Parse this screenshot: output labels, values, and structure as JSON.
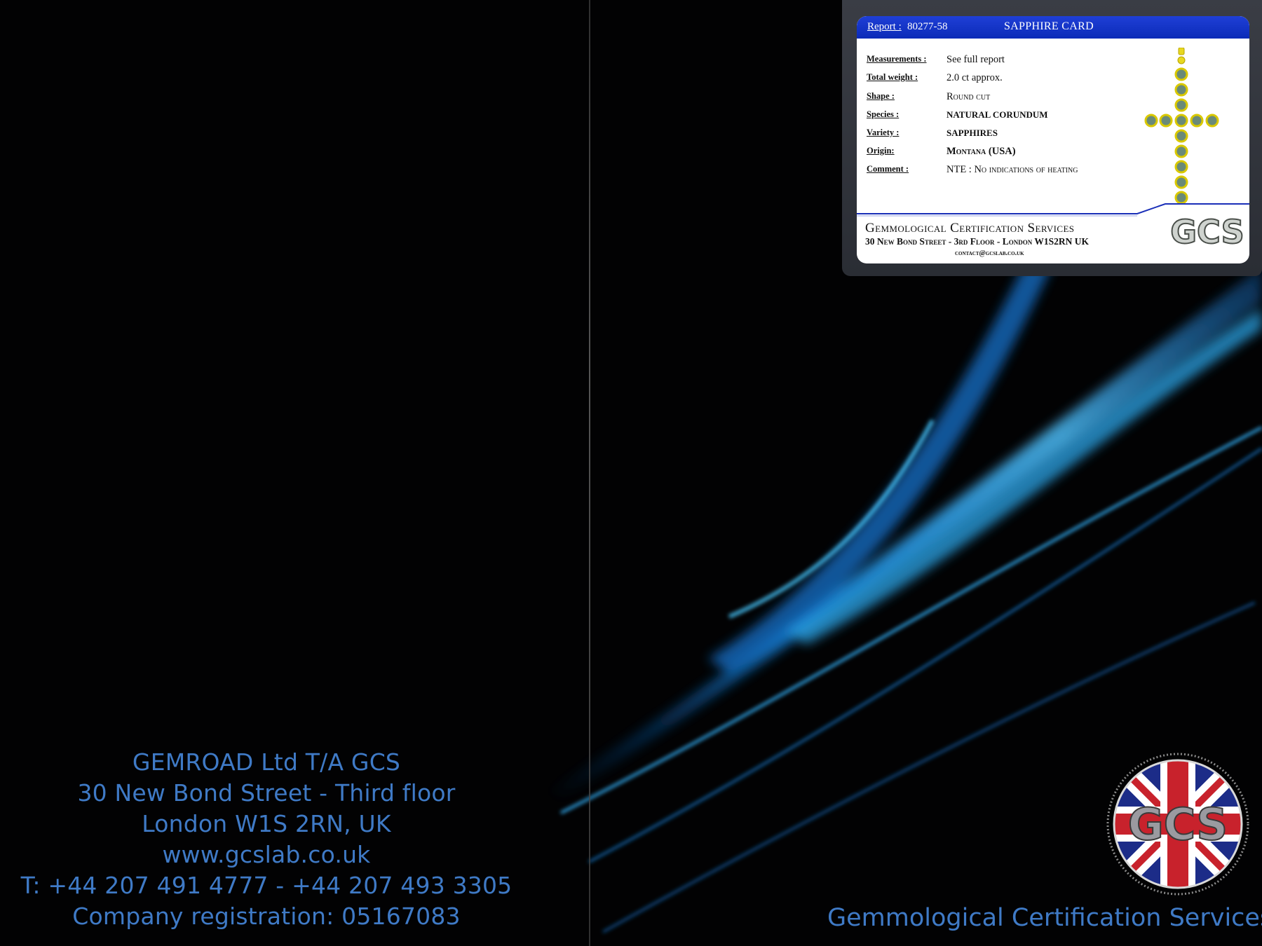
{
  "back_cover": {
    "company": "GEMROAD Ltd T/A GCS",
    "address_line1": "30 New Bond Street - Third floor",
    "address_line2": "London W1S 2RN, UK",
    "website": "www.gcslab.co.uk",
    "phone": "T: +44 207 491 4777 - +44 207 493 3305",
    "registration": "Company registration: 05167083"
  },
  "front_cover": {
    "title": "Gemmological Certification Services"
  },
  "card": {
    "report_label": "Report :",
    "report_number": "80277-58",
    "title": "SAPPHIRE CARD",
    "fields": [
      {
        "label": "Measurements :",
        "value": "See full report"
      },
      {
        "label": "Total weight :",
        "value": "2.0 ct approx."
      },
      {
        "label": "Shape :",
        "value": "Round cut"
      },
      {
        "label": "Species :",
        "value": "NATURAL CORUNDUM"
      },
      {
        "label": "Variety :",
        "value": "SAPPHIRES"
      },
      {
        "label": "Origin:",
        "value": "Montana (USA)"
      },
      {
        "label": "Comment :",
        "value": "NTE : No indications of heating"
      }
    ],
    "lab_name": "Gemmological Certification Services",
    "lab_address": "30 New Bond Street - 3rd Floor - London W1S2RN UK",
    "lab_contact": "contact@gcslab.co.uk",
    "logo_text": "GCS"
  },
  "badge": {
    "text": "GCS"
  },
  "colors": {
    "background": "#020203",
    "text_blue": "#3f7ac6",
    "card_header": "#0b2bb8",
    "swoosh": "#1ea4ff"
  }
}
